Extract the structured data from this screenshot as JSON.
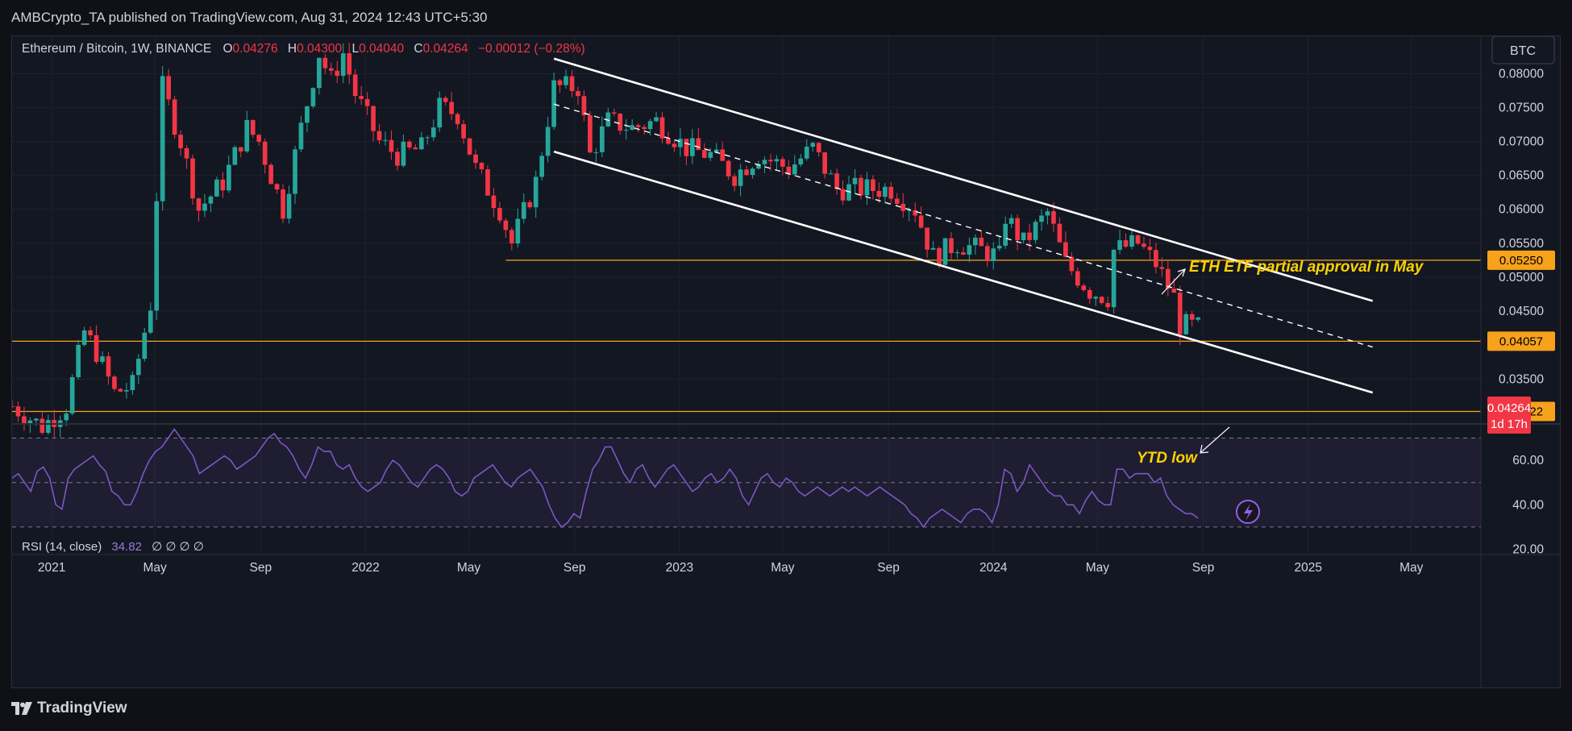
{
  "publisher_line": "AMBCrypto_TA published on TradingView.com, Aug 31, 2024 12:43 UTC+5:30",
  "brand": "TradingView",
  "header": {
    "symbol": "Ethereum / Bitcoin, 1W, BINANCE",
    "o_label": "O",
    "o_value": "0.04276",
    "h_label": "H",
    "h_value": "0.04300",
    "l_label": "L",
    "l_value": "0.04040",
    "c_label": "C",
    "c_value": "0.04264",
    "change": "−0.00012 (−0.28%)"
  },
  "currency_button": "BTC",
  "price_tag": {
    "value": "0.04264",
    "countdown": "1d 17h"
  },
  "rsi_legend": {
    "name": "RSI (14, close)",
    "value": "34.82",
    "extras": "∅ ∅ ∅ ∅"
  },
  "annotations": {
    "etf": "ETH ETF partial approval in May",
    "ytd": "YTD low"
  },
  "colors": {
    "up": "#26a69a",
    "down": "#f23645",
    "level": "#f7a21b",
    "rsi": "#7e57c2",
    "annotation": "#ffd200",
    "channel": "#ffffff"
  },
  "chart_data": [
    {
      "type": "candlestick",
      "title": "Ethereum / Bitcoin, 1W, BINANCE",
      "x_ticks": [
        "2021",
        "May",
        "Sep",
        "2022",
        "May",
        "Sep",
        "2023",
        "May",
        "Sep",
        "2024",
        "May",
        "Sep",
        "2025",
        "May"
      ],
      "y_ticks": [
        "0.08000",
        "0.07500",
        "0.07000",
        "0.06500",
        "0.06000",
        "0.05500",
        "0.05000",
        "0.04500",
        "0.03500"
      ],
      "ylim": [
        0.0285,
        0.0855
      ],
      "horizontal_levels": [
        {
          "value": 0.0525,
          "label": "0.05250"
        },
        {
          "value": 0.04057,
          "label": "0.04057"
        },
        {
          "value": 0.03022,
          "label": "0.03022"
        }
      ],
      "channel": {
        "upper": [
          [
            "2022-08-08",
            0.0822
          ],
          [
            "2025-03-17",
            0.0465
          ]
        ],
        "lower": [
          [
            "2022-08-08",
            0.0685
          ],
          [
            "2025-03-17",
            0.033
          ]
        ],
        "middle_dashed": [
          [
            "2022-08-08",
            0.0755
          ],
          [
            "2025-03-17",
            0.0397
          ]
        ]
      },
      "keypoints": [
        [
          "2020-11-16",
          0.031
        ],
        [
          "2020-12-21",
          0.028
        ],
        [
          "2021-01-18",
          0.031
        ],
        [
          "2021-02-08",
          0.042
        ],
        [
          "2021-02-22",
          0.039
        ],
        [
          "2021-03-15",
          0.033
        ],
        [
          "2021-04-05",
          0.034
        ],
        [
          "2021-04-26",
          0.046
        ],
        [
          "2021-05-03",
          0.062
        ],
        [
          "2021-05-10",
          0.078
        ],
        [
          "2021-05-31",
          0.07
        ],
        [
          "2021-06-21",
          0.06
        ],
        [
          "2021-07-19",
          0.064
        ],
        [
          "2021-08-16",
          0.072
        ],
        [
          "2021-08-30",
          0.07
        ],
        [
          "2021-09-27",
          0.06
        ],
        [
          "2021-10-18",
          0.072
        ],
        [
          "2021-11-08",
          0.083
        ],
        [
          "2021-11-22",
          0.079
        ],
        [
          "2021-12-06",
          0.083
        ],
        [
          "2021-12-20",
          0.077
        ],
        [
          "2022-01-17",
          0.07
        ],
        [
          "2022-02-07",
          0.068
        ],
        [
          "2022-03-07",
          0.069
        ],
        [
          "2022-03-28",
          0.075
        ],
        [
          "2022-04-18",
          0.074
        ],
        [
          "2022-05-09",
          0.066
        ],
        [
          "2022-06-06",
          0.06
        ],
        [
          "2022-06-20",
          0.055
        ],
        [
          "2022-07-18",
          0.064
        ],
        [
          "2022-08-08",
          0.078
        ],
        [
          "2022-09-05",
          0.078
        ],
        [
          "2022-09-19",
          0.068
        ],
        [
          "2022-10-10",
          0.073
        ],
        [
          "2022-11-07",
          0.072
        ],
        [
          "2022-12-05",
          0.073
        ],
        [
          "2023-01-09",
          0.069
        ],
        [
          "2023-02-06",
          0.068
        ],
        [
          "2023-03-06",
          0.065
        ],
        [
          "2023-04-03",
          0.068
        ],
        [
          "2023-05-08",
          0.066
        ],
        [
          "2023-06-05",
          0.069
        ],
        [
          "2023-07-03",
          0.063
        ],
        [
          "2023-08-07",
          0.063
        ],
        [
          "2023-09-04",
          0.063
        ],
        [
          "2023-10-02",
          0.06
        ],
        [
          "2023-10-23",
          0.053
        ],
        [
          "2023-11-20",
          0.055
        ],
        [
          "2023-12-18",
          0.054
        ],
        [
          "2024-01-08",
          0.053
        ],
        [
          "2024-01-15",
          0.059
        ],
        [
          "2024-02-05",
          0.055
        ],
        [
          "2024-03-04",
          0.0595
        ],
        [
          "2024-03-25",
          0.052
        ],
        [
          "2024-04-22",
          0.048
        ],
        [
          "2024-05-13",
          0.047
        ],
        [
          "2024-05-20",
          0.054
        ],
        [
          "2024-06-17",
          0.055
        ],
        [
          "2024-07-08",
          0.052
        ],
        [
          "2024-07-29",
          0.047
        ],
        [
          "2024-08-05",
          0.043
        ],
        [
          "2024-08-26",
          0.0426
        ]
      ]
    },
    {
      "type": "line",
      "title": "RSI (14, close)",
      "y_ticks": [
        "60.00",
        "40.00",
        "20.00"
      ],
      "ylim": [
        18,
        76
      ],
      "band": [
        30,
        70
      ],
      "middle": 50,
      "values": [
        52,
        54,
        50,
        46,
        55,
        57,
        52,
        40,
        38,
        52,
        56,
        58,
        60,
        62,
        58,
        55,
        46,
        44,
        40,
        40,
        46,
        54,
        60,
        64,
        66,
        70,
        74,
        70,
        66,
        62,
        54,
        56,
        58,
        60,
        62,
        60,
        56,
        58,
        60,
        62,
        66,
        70,
        72,
        68,
        66,
        62,
        56,
        52,
        58,
        66,
        64,
        64,
        58,
        56,
        58,
        52,
        48,
        46,
        48,
        50,
        56,
        60,
        58,
        54,
        50,
        48,
        52,
        56,
        58,
        56,
        52,
        46,
        44,
        46,
        52,
        54,
        56,
        58,
        54,
        50,
        48,
        52,
        54,
        56,
        52,
        48,
        40,
        34,
        30,
        32,
        36,
        34,
        46,
        56,
        60,
        66,
        66,
        60,
        54,
        50,
        56,
        58,
        52,
        48,
        52,
        56,
        58,
        54,
        50,
        46,
        48,
        52,
        54,
        50,
        52,
        56,
        52,
        44,
        40,
        46,
        52,
        54,
        50,
        48,
        52,
        50,
        46,
        44,
        46,
        48,
        46,
        44,
        46,
        48,
        46,
        48,
        46,
        44,
        46,
        48,
        46,
        44,
        42,
        40,
        36,
        34,
        30,
        34,
        36,
        38,
        36,
        34,
        32,
        36,
        38,
        38,
        36,
        32,
        40,
        56,
        54,
        46,
        50,
        58,
        54,
        50,
        46,
        44,
        44,
        40,
        40,
        36,
        42,
        46,
        42,
        40,
        40,
        56,
        56,
        52,
        54,
        54,
        54,
        50,
        52,
        44,
        40,
        38,
        36,
        36,
        34
      ]
    }
  ]
}
